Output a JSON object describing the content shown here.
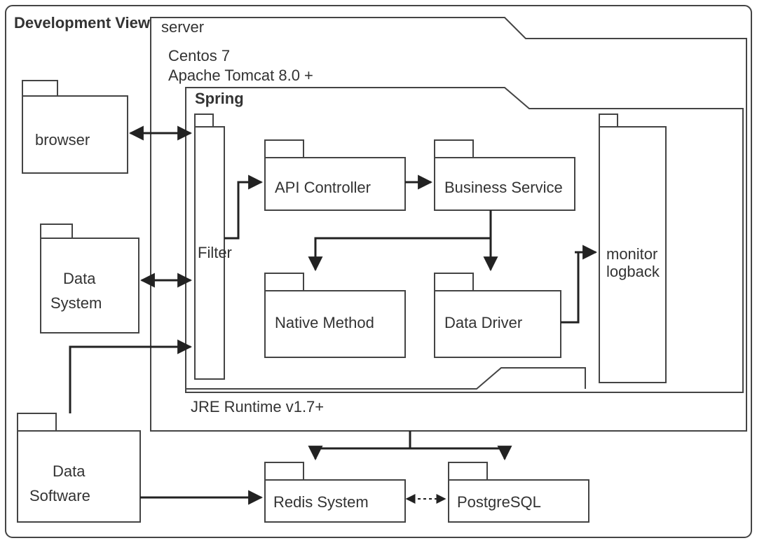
{
  "title": "Development View",
  "server": {
    "label": "server",
    "os": "Centos 7",
    "webserver": "Apache Tomcat 8.0 +",
    "runtime": "JRE Runtime v1.7+"
  },
  "spring": {
    "label": "Spring",
    "filter": "Filter",
    "api_controller": "API Controller",
    "business_service": "Business Service",
    "native_method": "Native Method",
    "data_driver": "Data Driver",
    "monitor": "monitor\nlogback"
  },
  "external": {
    "browser": "browser",
    "data_system": "Data\nSystem",
    "data_software": "Data\nSoftware"
  },
  "storage": {
    "redis": "Redis System",
    "postgres": "PostgreSQL"
  }
}
